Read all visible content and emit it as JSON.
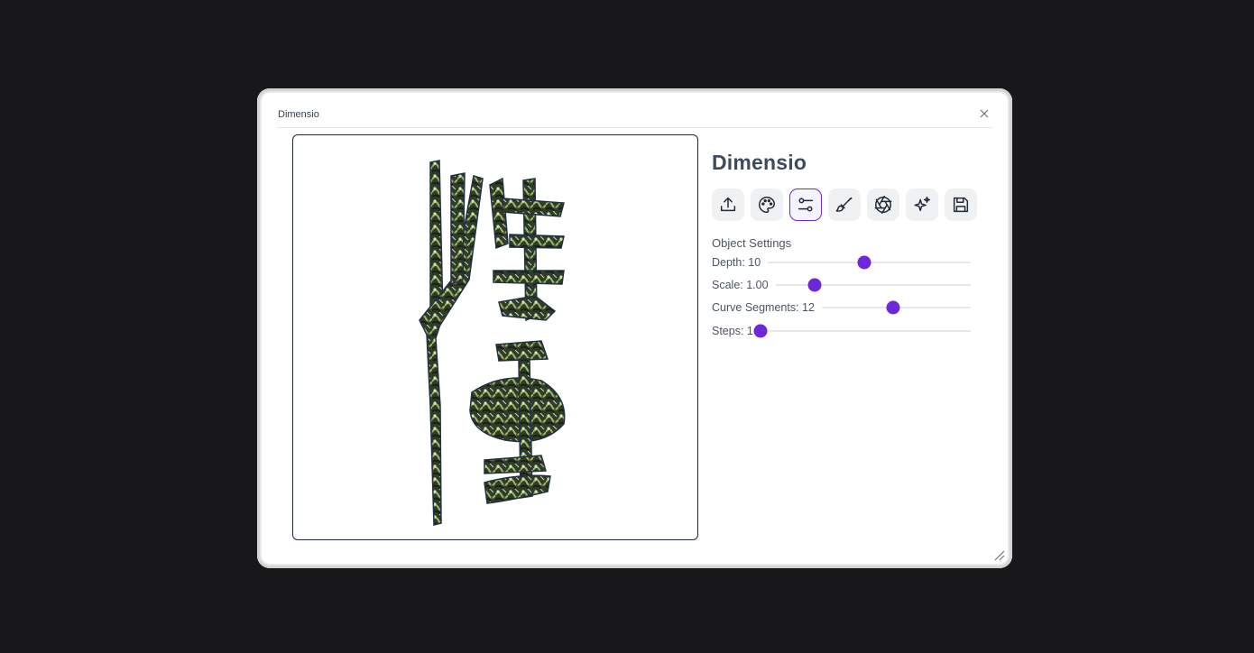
{
  "window": {
    "title": "Dimensio"
  },
  "app": {
    "title": "Dimensio"
  },
  "toolbar": {
    "buttons": [
      {
        "icon": "upload-icon",
        "active": false
      },
      {
        "icon": "palette-icon",
        "active": false
      },
      {
        "icon": "sliders-icon",
        "active": true
      },
      {
        "icon": "brush-icon",
        "active": false
      },
      {
        "icon": "aperture-icon",
        "active": false
      },
      {
        "icon": "sparkles-icon",
        "active": false
      },
      {
        "icon": "save-icon",
        "active": false
      }
    ]
  },
  "settings": {
    "title": "Object Settings",
    "sliders": [
      {
        "label": "Depth: 10",
        "value": 10,
        "min": 1,
        "max": 20
      },
      {
        "label": "Scale: 1.00",
        "value": 1.0,
        "min": 0.5,
        "max": 3.0
      },
      {
        "label": "Curve Segments: 12",
        "value": 12,
        "min": 1,
        "max": 24
      },
      {
        "label": "Steps: 1",
        "value": 1,
        "min": 1,
        "max": 10
      }
    ]
  },
  "colors": {
    "accent": "#6d28d9",
    "background": "#18181a",
    "panel": "#ffffff"
  }
}
